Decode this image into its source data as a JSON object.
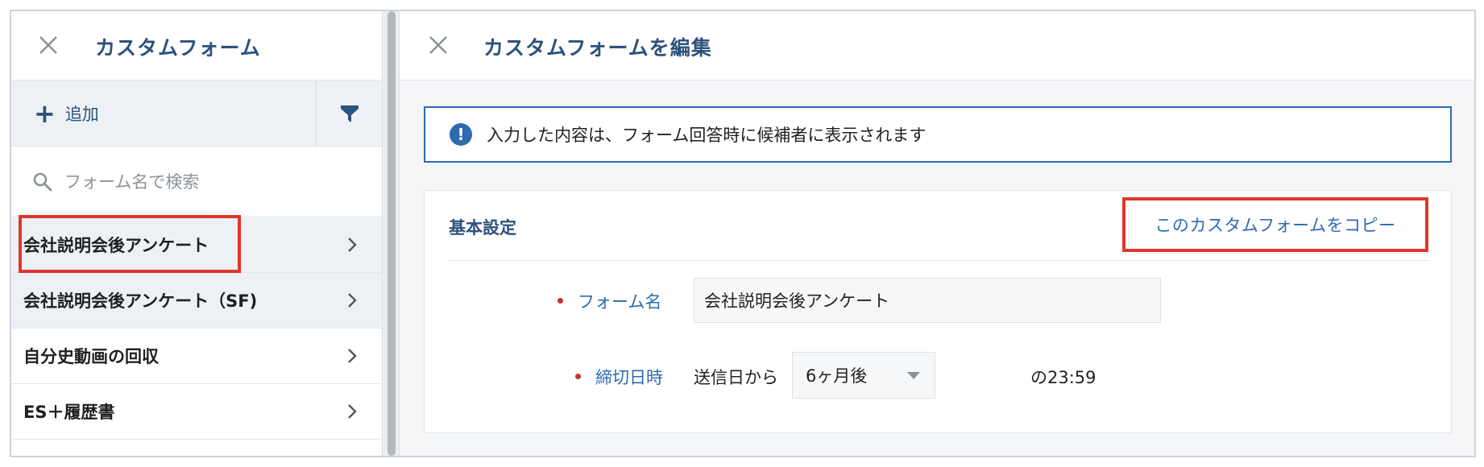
{
  "left_panel": {
    "title": "カスタムフォーム",
    "add_label": "追加",
    "search_placeholder": "フォーム名で検索",
    "items": [
      {
        "label": "会社説明会後アンケート"
      },
      {
        "label": "会社説明会後アンケート（SF)"
      },
      {
        "label": "自分史動画の回収"
      },
      {
        "label": "ES＋履歴書"
      }
    ]
  },
  "right_panel": {
    "title": "カスタムフォームを編集",
    "notice": "入力した内容は、フォーム回答時に候補者に表示されます",
    "section_title": "基本設定",
    "copy_button": "このカスタムフォームをコピー",
    "form_name_label": "フォーム名",
    "form_name_value": "会社説明会後アンケート",
    "deadline_label": "締切日時",
    "deadline_prefix": "送信日から",
    "deadline_select": "6ヶ月後",
    "deadline_suffix": "の23:59"
  },
  "colors": {
    "brand_navy": "#2d527c",
    "link_blue": "#2d6ab0",
    "highlight_red": "#e0352b",
    "required_red": "#c9302c"
  },
  "icons": [
    "close-icon",
    "plus-icon",
    "filter-icon",
    "search-icon",
    "chevron-right-icon",
    "info-icon",
    "caret-down-icon"
  ]
}
